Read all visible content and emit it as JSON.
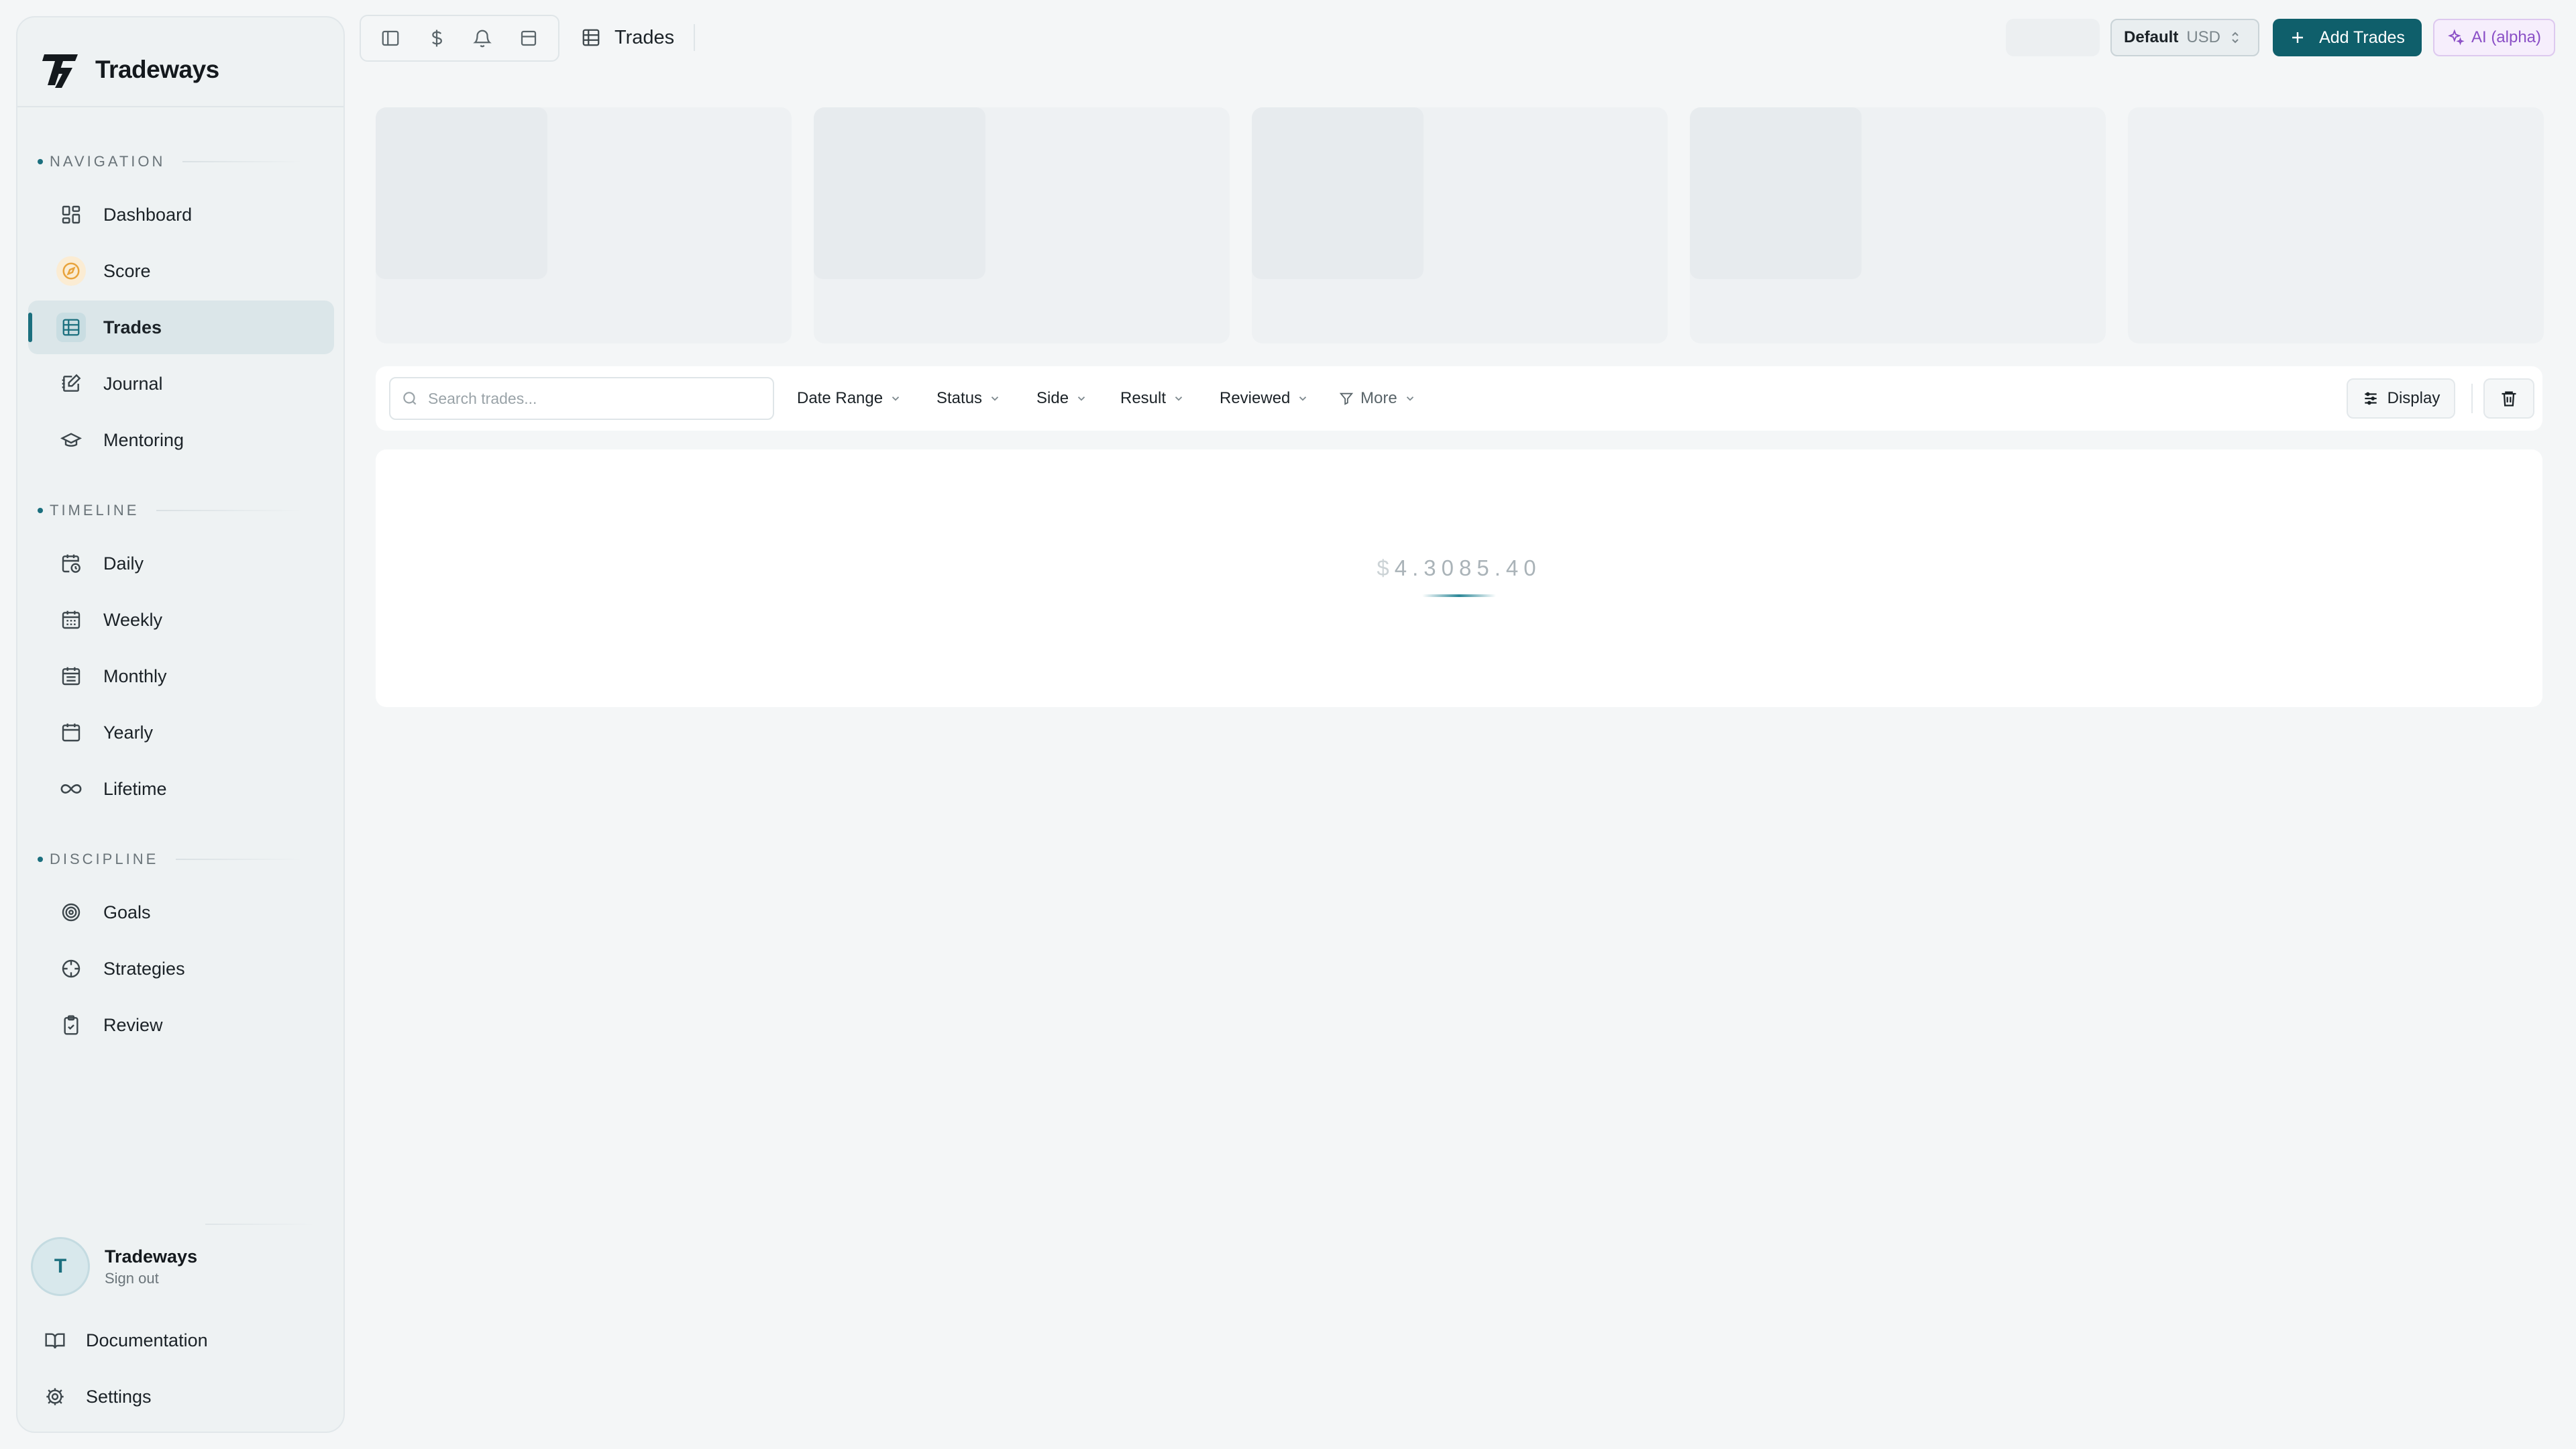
{
  "app": {
    "brand_name": "Tradeways"
  },
  "sidebar": {
    "sections": [
      {
        "label": "NAVIGATION",
        "items": [
          {
            "label": "Dashboard",
            "icon": "dashboard-icon"
          },
          {
            "label": "Score",
            "icon": "compass-icon"
          },
          {
            "label": "Trades",
            "icon": "table-icon",
            "active": true
          },
          {
            "label": "Journal",
            "icon": "journal-icon"
          },
          {
            "label": "Mentoring",
            "icon": "graduation-cap-icon"
          }
        ]
      },
      {
        "label": "TIMELINE",
        "items": [
          {
            "label": "Daily",
            "icon": "calendar-clock-icon"
          },
          {
            "label": "Weekly",
            "icon": "calendar-week-icon"
          },
          {
            "label": "Monthly",
            "icon": "calendar-month-icon"
          },
          {
            "label": "Yearly",
            "icon": "calendar-icon"
          },
          {
            "label": "Lifetime",
            "icon": "infinity-icon"
          }
        ]
      },
      {
        "label": "DISCIPLINE",
        "items": [
          {
            "label": "Goals",
            "icon": "target-icon"
          },
          {
            "label": "Strategies",
            "icon": "crosshair-icon"
          },
          {
            "label": "Review",
            "icon": "clipboard-check-icon"
          }
        ]
      }
    ],
    "user": {
      "initial": "T",
      "name": "Tradeways",
      "action": "Sign out"
    },
    "footer": {
      "documentation": "Documentation",
      "settings": "Settings"
    }
  },
  "topbar": {
    "page_title": "Trades",
    "account": {
      "name": "Default",
      "currency": "USD"
    },
    "add_trades_label": "Add Trades",
    "ai_label": "AI (alpha)"
  },
  "filters": {
    "search_placeholder": "Search trades...",
    "chips": [
      "Date Range",
      "Status",
      "Side",
      "Result",
      "Reviewed",
      "More"
    ],
    "display_label": "Display"
  },
  "loading": {
    "currency_symbol": "$",
    "value": "4.3085.40"
  },
  "colors": {
    "accent": "#0f5f6b",
    "ai": "#8a4fc6",
    "score_icon": "#e8a33c"
  }
}
